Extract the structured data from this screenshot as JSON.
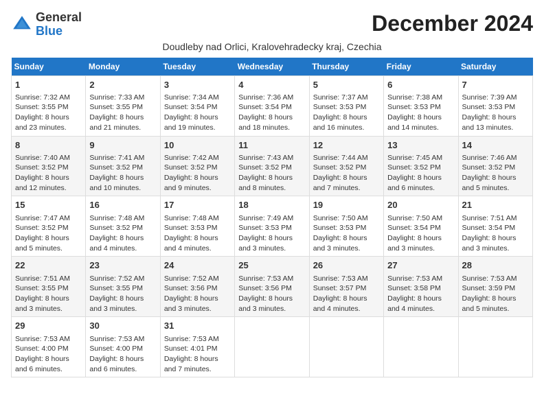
{
  "logo": {
    "general": "General",
    "blue": "Blue"
  },
  "title": "December 2024",
  "subtitle": "Doudleby nad Orlici, Kralovehradecky kraj, Czechia",
  "headers": [
    "Sunday",
    "Monday",
    "Tuesday",
    "Wednesday",
    "Thursday",
    "Friday",
    "Saturday"
  ],
  "weeks": [
    [
      {
        "day": "1",
        "info": "Sunrise: 7:32 AM\nSunset: 3:55 PM\nDaylight: 8 hours and 23 minutes."
      },
      {
        "day": "2",
        "info": "Sunrise: 7:33 AM\nSunset: 3:55 PM\nDaylight: 8 hours and 21 minutes."
      },
      {
        "day": "3",
        "info": "Sunrise: 7:34 AM\nSunset: 3:54 PM\nDaylight: 8 hours and 19 minutes."
      },
      {
        "day": "4",
        "info": "Sunrise: 7:36 AM\nSunset: 3:54 PM\nDaylight: 8 hours and 18 minutes."
      },
      {
        "day": "5",
        "info": "Sunrise: 7:37 AM\nSunset: 3:53 PM\nDaylight: 8 hours and 16 minutes."
      },
      {
        "day": "6",
        "info": "Sunrise: 7:38 AM\nSunset: 3:53 PM\nDaylight: 8 hours and 14 minutes."
      },
      {
        "day": "7",
        "info": "Sunrise: 7:39 AM\nSunset: 3:53 PM\nDaylight: 8 hours and 13 minutes."
      }
    ],
    [
      {
        "day": "8",
        "info": "Sunrise: 7:40 AM\nSunset: 3:52 PM\nDaylight: 8 hours and 12 minutes."
      },
      {
        "day": "9",
        "info": "Sunrise: 7:41 AM\nSunset: 3:52 PM\nDaylight: 8 hours and 10 minutes."
      },
      {
        "day": "10",
        "info": "Sunrise: 7:42 AM\nSunset: 3:52 PM\nDaylight: 8 hours and 9 minutes."
      },
      {
        "day": "11",
        "info": "Sunrise: 7:43 AM\nSunset: 3:52 PM\nDaylight: 8 hours and 8 minutes."
      },
      {
        "day": "12",
        "info": "Sunrise: 7:44 AM\nSunset: 3:52 PM\nDaylight: 8 hours and 7 minutes."
      },
      {
        "day": "13",
        "info": "Sunrise: 7:45 AM\nSunset: 3:52 PM\nDaylight: 8 hours and 6 minutes."
      },
      {
        "day": "14",
        "info": "Sunrise: 7:46 AM\nSunset: 3:52 PM\nDaylight: 8 hours and 5 minutes."
      }
    ],
    [
      {
        "day": "15",
        "info": "Sunrise: 7:47 AM\nSunset: 3:52 PM\nDaylight: 8 hours and 5 minutes."
      },
      {
        "day": "16",
        "info": "Sunrise: 7:48 AM\nSunset: 3:52 PM\nDaylight: 8 hours and 4 minutes."
      },
      {
        "day": "17",
        "info": "Sunrise: 7:48 AM\nSunset: 3:53 PM\nDaylight: 8 hours and 4 minutes."
      },
      {
        "day": "18",
        "info": "Sunrise: 7:49 AM\nSunset: 3:53 PM\nDaylight: 8 hours and 3 minutes."
      },
      {
        "day": "19",
        "info": "Sunrise: 7:50 AM\nSunset: 3:53 PM\nDaylight: 8 hours and 3 minutes."
      },
      {
        "day": "20",
        "info": "Sunrise: 7:50 AM\nSunset: 3:54 PM\nDaylight: 8 hours and 3 minutes."
      },
      {
        "day": "21",
        "info": "Sunrise: 7:51 AM\nSunset: 3:54 PM\nDaylight: 8 hours and 3 minutes."
      }
    ],
    [
      {
        "day": "22",
        "info": "Sunrise: 7:51 AM\nSunset: 3:55 PM\nDaylight: 8 hours and 3 minutes."
      },
      {
        "day": "23",
        "info": "Sunrise: 7:52 AM\nSunset: 3:55 PM\nDaylight: 8 hours and 3 minutes."
      },
      {
        "day": "24",
        "info": "Sunrise: 7:52 AM\nSunset: 3:56 PM\nDaylight: 8 hours and 3 minutes."
      },
      {
        "day": "25",
        "info": "Sunrise: 7:53 AM\nSunset: 3:56 PM\nDaylight: 8 hours and 3 minutes."
      },
      {
        "day": "26",
        "info": "Sunrise: 7:53 AM\nSunset: 3:57 PM\nDaylight: 8 hours and 4 minutes."
      },
      {
        "day": "27",
        "info": "Sunrise: 7:53 AM\nSunset: 3:58 PM\nDaylight: 8 hours and 4 minutes."
      },
      {
        "day": "28",
        "info": "Sunrise: 7:53 AM\nSunset: 3:59 PM\nDaylight: 8 hours and 5 minutes."
      }
    ],
    [
      {
        "day": "29",
        "info": "Sunrise: 7:53 AM\nSunset: 4:00 PM\nDaylight: 8 hours and 6 minutes."
      },
      {
        "day": "30",
        "info": "Sunrise: 7:53 AM\nSunset: 4:00 PM\nDaylight: 8 hours and 6 minutes."
      },
      {
        "day": "31",
        "info": "Sunrise: 7:53 AM\nSunset: 4:01 PM\nDaylight: 8 hours and 7 minutes."
      },
      null,
      null,
      null,
      null
    ]
  ]
}
